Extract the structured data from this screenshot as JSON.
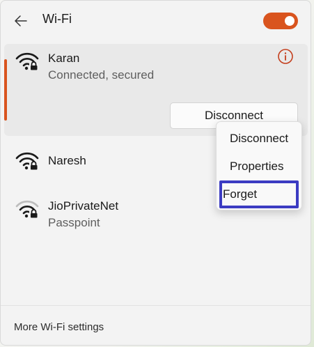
{
  "header": {
    "back_icon": "arrow-left-icon",
    "title": "Wi-Fi",
    "toggle_state": "on",
    "accent_color": "#d9541e"
  },
  "networks": [
    {
      "name": "Karan",
      "status": "Connected, secured",
      "icon": "wifi-secured-icon",
      "action_label": "Disconnect",
      "info_icon": "info-icon"
    },
    {
      "name": "Naresh",
      "icon": "wifi-secured-icon"
    },
    {
      "name": "JioPrivateNet",
      "status": "Passpoint",
      "icon": "wifi-secured-weak-icon"
    }
  ],
  "context_menu": {
    "items": [
      {
        "label": "Disconnect"
      },
      {
        "label": "Properties"
      },
      {
        "label": "Forget",
        "focused": true
      }
    ],
    "focus_color": "#3c3cc2"
  },
  "footer": {
    "link": "More Wi-Fi settings"
  }
}
